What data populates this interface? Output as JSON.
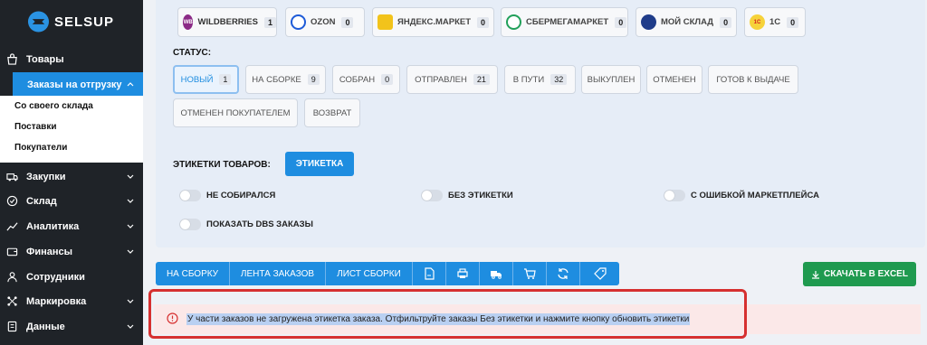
{
  "brand": {
    "name": "SELSUP"
  },
  "sidebar": {
    "items": [
      {
        "label": "Товары",
        "icon": "shop-icon"
      },
      {
        "label": "Заказы на отгрузку",
        "active": true
      },
      {
        "label": "Закупки",
        "icon": "truck-icon"
      },
      {
        "label": "Склад",
        "icon": "clock-icon"
      },
      {
        "label": "Аналитика",
        "icon": "chart-icon"
      },
      {
        "label": "Финансы",
        "icon": "wallet-icon"
      },
      {
        "label": "Сотрудники",
        "icon": "user-icon"
      },
      {
        "label": "Маркировка",
        "icon": "network-icon"
      },
      {
        "label": "Данные",
        "icon": "document-icon"
      }
    ],
    "subitems": [
      "Со своего склада",
      "Поставки",
      "Покупатели"
    ]
  },
  "marketplaces": [
    {
      "label": "WILDBERRIES",
      "count": "1",
      "logo": "WB",
      "color": "#8b2a86"
    },
    {
      "label": "OZON",
      "count": "0",
      "logo": "",
      "color": "#1e5bd8"
    },
    {
      "label": "ЯНДЕКС.МАРКЕТ",
      "count": "0",
      "logo": "",
      "color": "#f2c31b"
    },
    {
      "label": "СБЕРМЕГАМАРКЕТ",
      "count": "0",
      "logo": "",
      "color": "#22a05a"
    },
    {
      "label": "МОЙ СКЛАД",
      "count": "0",
      "logo": "",
      "color": "#1f3c8a"
    },
    {
      "label": "1C",
      "count": "0",
      "logo": "1C",
      "color": "#f6d23a"
    }
  ],
  "status": {
    "title": "СТАТУС:",
    "buttons": [
      {
        "label": "НОВЫЙ",
        "count": "1"
      },
      {
        "label": "НА СБОРКЕ",
        "count": "9"
      },
      {
        "label": "СОБРАН",
        "count": "0"
      },
      {
        "label": "ОТПРАВЛЕН",
        "count": "21"
      },
      {
        "label": "В ПУТИ",
        "count": "32"
      },
      {
        "label": "ВЫКУПЛЕН"
      },
      {
        "label": "ОТМЕНЕН"
      },
      {
        "label": "ГОТОВ К ВЫДАЧЕ"
      },
      {
        "label": "ОТМЕНЕН ПОКУПАТЕЛЕМ"
      },
      {
        "label": "ВОЗВРАТ"
      }
    ]
  },
  "labels": {
    "title": "ЭТИКЕТКИ ТОВАРОВ:",
    "button": "ЭТИКЕТКА"
  },
  "toggles": [
    "НЕ СОБИРАЛСЯ",
    "БЕЗ ЭТИКЕТКИ",
    "С ОШИБКОЙ МАРКЕТПЛЕЙСА",
    "ПОКАЗАТЬ DBS ЗАКАЗЫ"
  ],
  "actions": [
    "НА СБОРКУ",
    "ЛЕНТА ЗАКАЗОВ",
    "ЛИСТ СБОРКИ"
  ],
  "export_label": "СКАЧАТЬ В EXCEL",
  "alert": {
    "text": "У части заказов не загружена этикетка заказа. Отфильтруйте заказы Без этикетки и нажмите кнопку обновить этикетки"
  },
  "colors": {
    "accent": "#1e8de0",
    "sidebar": "#1f2328",
    "export": "#1f9a4f",
    "alert_border": "#d63030"
  }
}
